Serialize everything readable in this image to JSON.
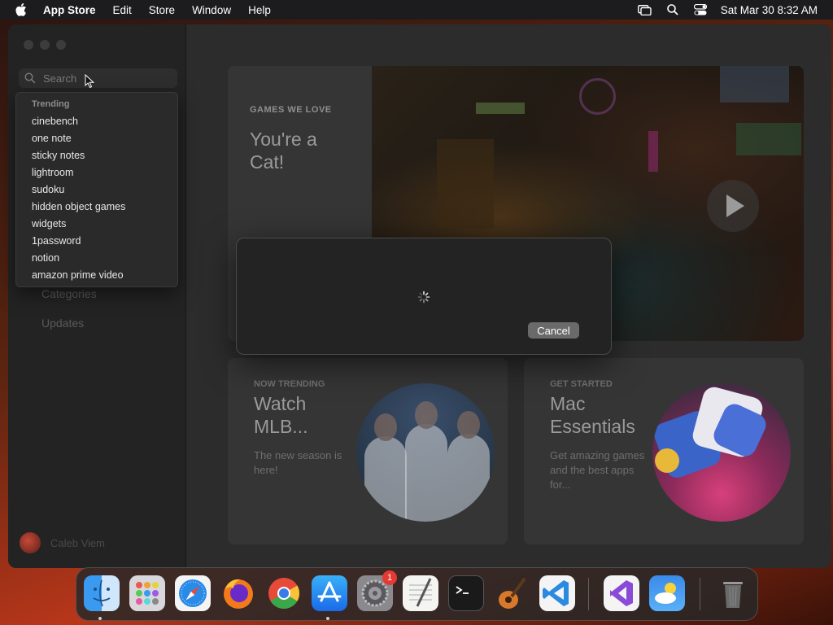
{
  "menubar": {
    "app_name": "App Store",
    "menus": [
      "Edit",
      "Store",
      "Window",
      "Help"
    ],
    "clock": "Sat Mar 30  8:32 AM"
  },
  "sidebar": {
    "search_placeholder": "Search",
    "nav": {
      "categories": "Categories",
      "updates": "Updates"
    },
    "user_name": "Caleb Viem"
  },
  "dropdown": {
    "header": "Trending",
    "items": [
      "cinebench",
      "one note",
      "sticky notes",
      "lightroom",
      "sudoku",
      "hidden object games",
      "widgets",
      "1password",
      "notion",
      "amazon prime video"
    ]
  },
  "hero": {
    "eyebrow": "GAMES WE LOVE",
    "title": "You're a Cat!"
  },
  "cards": [
    {
      "eyebrow": "NOW TRENDING",
      "title": "Watch MLB...",
      "desc": "The new season is here!"
    },
    {
      "eyebrow": "GET STARTED",
      "title": "Mac Essentials",
      "desc": "Get amazing games and the best apps for..."
    }
  ],
  "modal": {
    "cancel_label": "Cancel"
  },
  "dock": {
    "badge": "1",
    "apps": [
      "finder-icon",
      "launchpad-icon",
      "safari-icon",
      "firefox-icon",
      "chrome-icon",
      "app-store-icon",
      "system-settings-icon",
      "textedit-icon",
      "terminal-icon",
      "garageband-icon",
      "vscode-icon",
      "visual-studio-icon",
      "weather-icon",
      "trash-icon"
    ]
  }
}
